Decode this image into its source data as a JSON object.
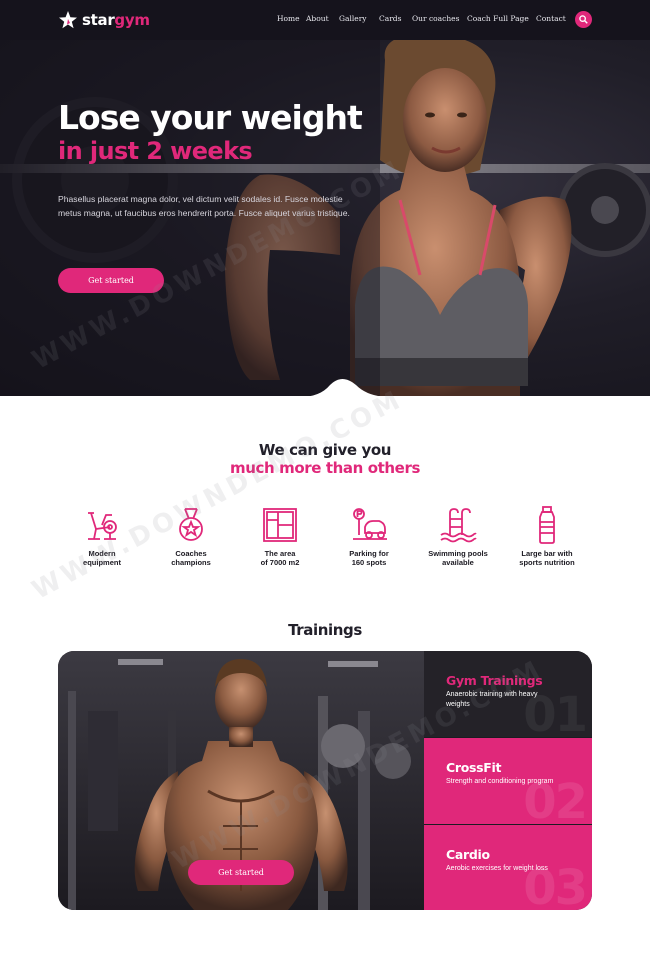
{
  "brand": {
    "name_part1": "star",
    "name_part2": "gym",
    "accent": "#e0287a"
  },
  "nav": {
    "items": [
      {
        "label": "Home"
      },
      {
        "label": "About"
      },
      {
        "label": "Gallery"
      },
      {
        "label": "Cards"
      },
      {
        "label": "Our coaches"
      },
      {
        "label": "Coach Full Page"
      },
      {
        "label": "Contact"
      }
    ],
    "search_icon": "search-icon"
  },
  "hero": {
    "title_line1": "Lose your weight",
    "title_line2": "in just 2 weeks",
    "text": "Phasellus placerat magna dolor, vel dictum velit sodales id. Fusce molestie metus magna, ut faucibus eros hendrerit porta. Fusce aliquet varius tristique.",
    "button": "Get started"
  },
  "features": {
    "title_line1": "We can give you",
    "title_line2": "much more than others",
    "items": [
      {
        "icon": "exercise-bike-icon",
        "label_line1": "Modern",
        "label_line2": "equipment"
      },
      {
        "icon": "medal-icon",
        "label_line1": "Coaches",
        "label_line2": "champions"
      },
      {
        "icon": "floor-plan-icon",
        "label_line1": "The area",
        "label_line2": "of 7000 m2"
      },
      {
        "icon": "parking-car-icon",
        "label_line1": "Parking for",
        "label_line2": "160 spots"
      },
      {
        "icon": "swimming-pool-icon",
        "label_line1": "Swimming pools",
        "label_line2": "available"
      },
      {
        "icon": "bottle-icon",
        "label_line1": "Large bar with",
        "label_line2": "sports nutrition"
      }
    ]
  },
  "trainings": {
    "title": "Trainings",
    "button": "Get started",
    "items": [
      {
        "title": "Gym Trainings",
        "desc": "Anaerobic training with heavy weights",
        "num": "01"
      },
      {
        "title": "CrossFit",
        "desc": "Strength and conditioning program",
        "num": "02"
      },
      {
        "title": "Cardio",
        "desc": "Aerobic exercises for weight loss",
        "num": "03"
      }
    ]
  },
  "watermark": "WWW.DOWNDEMO.COM"
}
